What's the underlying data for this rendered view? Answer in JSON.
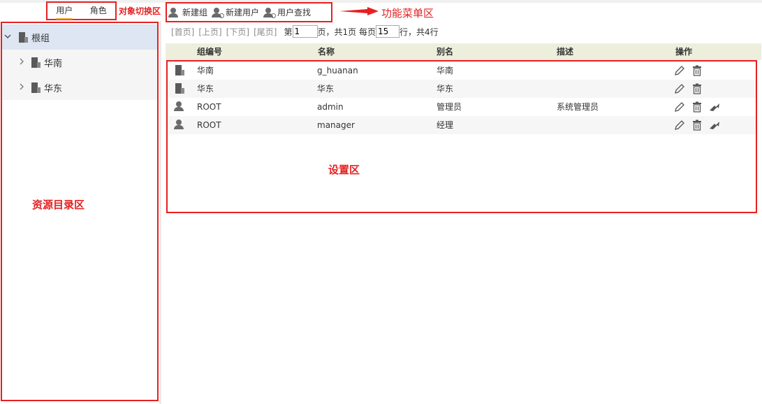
{
  "tabs": [
    {
      "label": "用户",
      "active": true
    },
    {
      "label": "角色",
      "active": false
    }
  ],
  "annotations": {
    "tab_area": "对象切换区",
    "toolbar_area": "功能菜单区",
    "sidebar_area": "资源目录区",
    "settings_area": "设置区"
  },
  "toolbar": {
    "new_group": "新建组",
    "new_user": "新建用户",
    "find_user": "用户查找"
  },
  "tree": {
    "root": {
      "label": "根组",
      "expanded": true
    },
    "children": [
      {
        "label": "华南"
      },
      {
        "label": "华东"
      }
    ]
  },
  "pager": {
    "first": "[首页]",
    "prev": "[上页]",
    "next": "[下页]",
    "last": "[尾页]",
    "page_prefix": "第",
    "page_value": "1",
    "page_suffix": "页，共1页 每页",
    "per_page_value": "15",
    "total_text": "行，共4行"
  },
  "table": {
    "columns": [
      "组编号",
      "名称",
      "别名",
      "描述",
      "操作"
    ],
    "rows": [
      {
        "type": "group",
        "group_id": "华南",
        "name": "g_huanan",
        "alias": "华南",
        "desc": "",
        "ops": [
          "edit",
          "delete"
        ]
      },
      {
        "type": "group",
        "group_id": "华东",
        "name": "华东",
        "alias": "华东",
        "desc": "",
        "ops": [
          "edit",
          "delete"
        ]
      },
      {
        "type": "user",
        "group_id": "ROOT",
        "name": "admin",
        "alias": "管理员",
        "desc": "系统管理员",
        "ops": [
          "edit",
          "delete",
          "assign"
        ]
      },
      {
        "type": "user",
        "group_id": "ROOT",
        "name": "manager",
        "alias": "经理",
        "desc": "",
        "ops": [
          "edit",
          "delete",
          "assign"
        ]
      }
    ]
  },
  "colors": {
    "annotation_red": "#e62020",
    "header_bg": "#eeeedd",
    "tree_selected_bg": "#dde6f2",
    "tab_underline": "#f0a030"
  }
}
